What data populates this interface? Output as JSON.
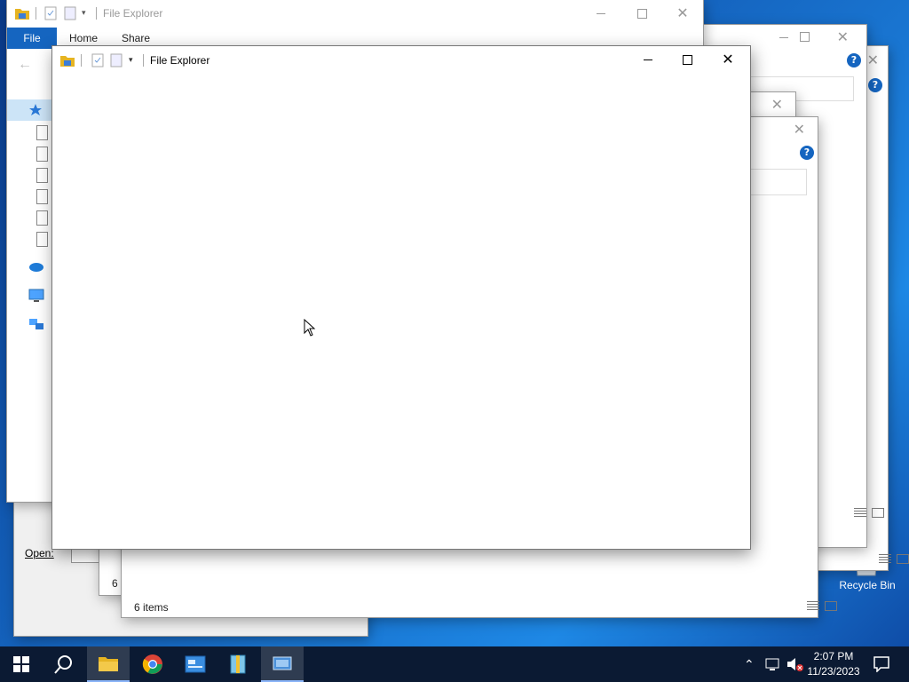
{
  "window_title": "File Explorer",
  "ribbon": {
    "file": "File",
    "home": "Home",
    "share": "Share"
  },
  "status_items": "6 items",
  "open_label": "Open:",
  "desktop": {
    "recycle_bin": "Recycle Bin"
  },
  "taskbar": {
    "clock_time": "2:07 PM",
    "clock_date": "11/23/2023",
    "apps": [
      "start-icon",
      "search-icon",
      "file-explorer-icon",
      "chrome-icon",
      "control-panel-icon",
      "archive-icon",
      "app-icon"
    ]
  },
  "colors": {
    "accent": "#1565c0",
    "taskbar": "#0b1a33",
    "file_tab": "#1565c0"
  }
}
